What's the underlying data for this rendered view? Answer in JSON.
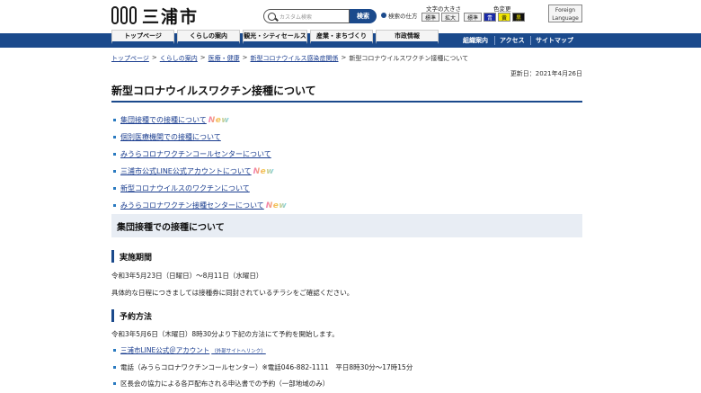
{
  "header": {
    "logo_text": "三浦市",
    "search_placeholder": "カスタム検索",
    "search_button": "検索",
    "search_help": "検索の仕方",
    "font_size_label": "文字の大きさ",
    "font_size_buttons": [
      "標準",
      "拡大"
    ],
    "color_label": "色変更",
    "color_buttons": [
      "標準",
      "青",
      "黄",
      "黒"
    ],
    "foreign_language": "Foreign Language"
  },
  "nav": {
    "tabs": [
      "トップページ",
      "くらしの案内",
      "観光・シティセールス",
      "産業・まちづくり",
      "市政情報"
    ],
    "right_links": [
      "組織案内",
      "アクセス",
      "サイトマップ"
    ]
  },
  "breadcrumb": [
    "トップページ",
    "くらしの案内",
    "医療・健康",
    "新型コロナウイルス感染症関係",
    "新型コロナウイルスワクチン接種について"
  ],
  "updated": "更新日：2021年4月26日",
  "page_title": "新型コロナウイルスワクチン接種について",
  "toc": [
    {
      "label": "集団接種での接種について",
      "new": true
    },
    {
      "label": "個別医療機関での接種について",
      "new": false
    },
    {
      "label": "みうらコロナワクチンコールセンターについて",
      "new": false
    },
    {
      "label": "三浦市公式LINE公式アカウントについて",
      "new": true
    },
    {
      "label": "新型コロナウイルスのワクチンについて",
      "new": false
    },
    {
      "label": "みうらコロナワクチン接種センターについて",
      "new": true
    }
  ],
  "new_badge": "New",
  "section": {
    "title": "集団接種での接種について",
    "period_heading": "実施期間",
    "period_text": "令和3年5月23日（日曜日）～8月11日（水曜日）",
    "period_note": "具体的な日程につきましては接種券に同封されているチラシをご確認ください。",
    "reserve_heading": "予約方法",
    "reserve_text": "令和3年5月6日（木曜日）8時30分より下記の方法にて予約を開始します。",
    "reserve_items": [
      {
        "label": "三浦市LINE公式＠アカウント",
        "ext": "（外部サイトへリンク）",
        "link": true
      },
      {
        "label": "電話（みうらコロナワクチンコールセンター）※電話046-882-1111　平日8時30分～17時15分",
        "link": false
      },
      {
        "label": "区長会の協力による各戸配布される申込書での予約（一部地域のみ）",
        "link": false
      }
    ]
  },
  "colors": {
    "primary": "#1b4a8c",
    "link": "#1a3d8f",
    "section_bg": "#e8edf4"
  }
}
